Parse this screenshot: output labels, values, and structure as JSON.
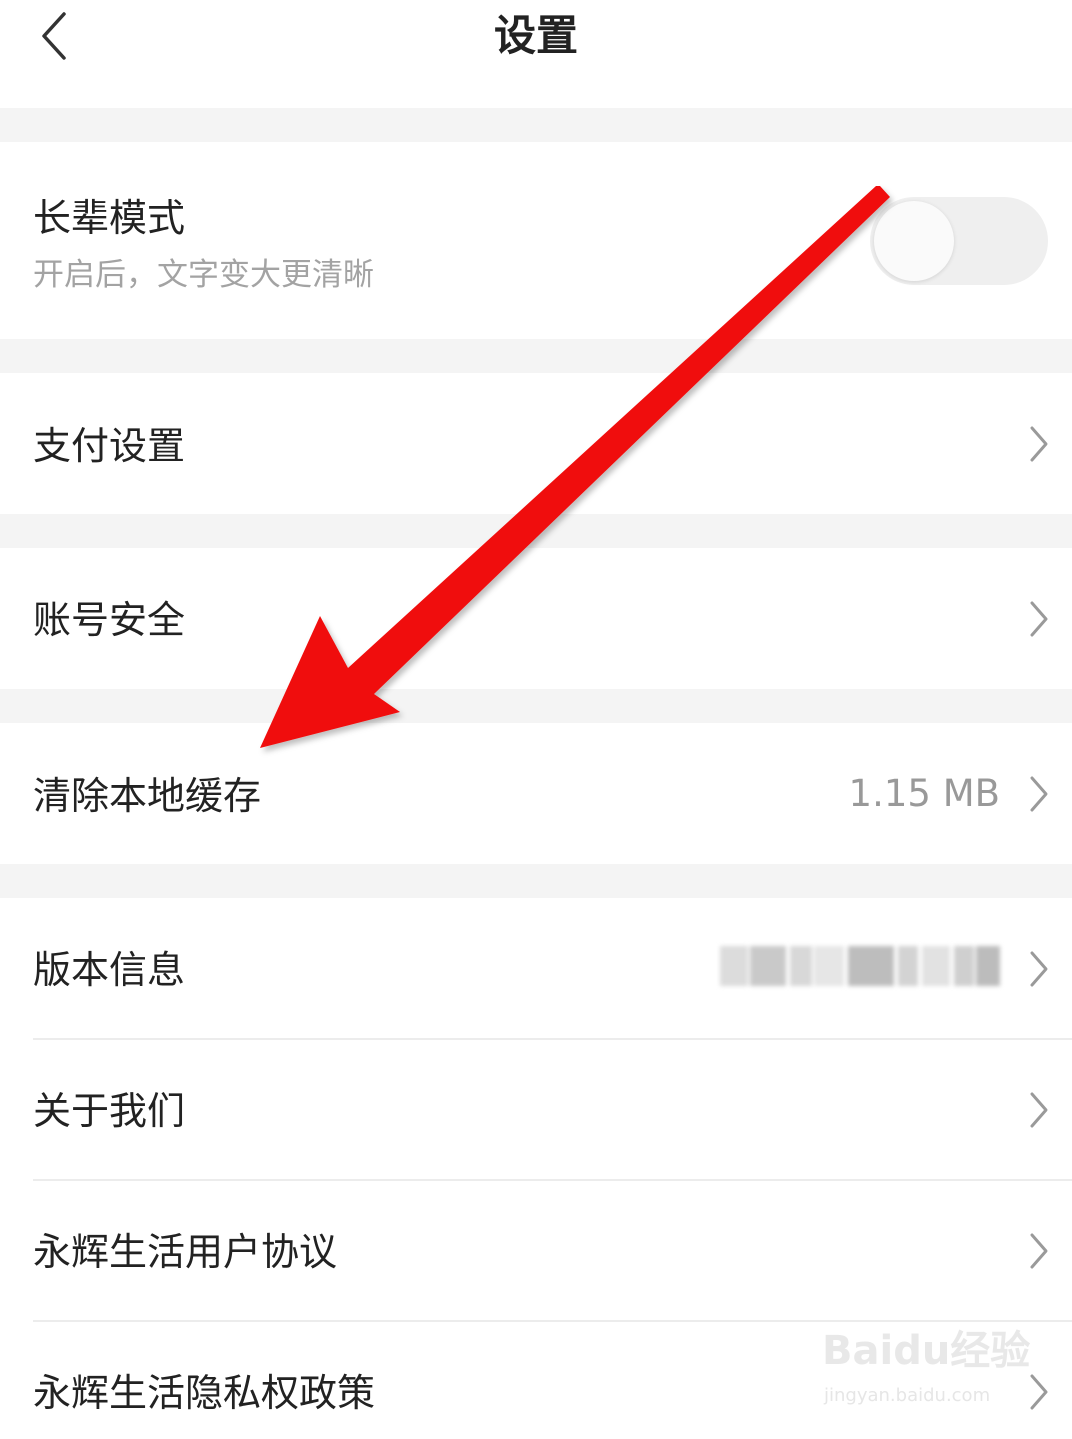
{
  "header": {
    "title": "设置",
    "back_icon": "chevron-left-icon"
  },
  "elder_mode": {
    "label": "长辈模式",
    "description": "开启后，文字变大更清晰",
    "toggle_on": false
  },
  "rows": {
    "payment": {
      "label": "支付设置"
    },
    "account_security": {
      "label": "账号安全"
    },
    "clear_cache": {
      "label": "清除本地缓存",
      "value": "1.15 MB"
    },
    "version": {
      "label": "版本信息"
    },
    "about": {
      "label": "关于我们"
    },
    "user_agreement": {
      "label": "永辉生活用户协议"
    },
    "privacy_policy": {
      "label": "永辉生活隐私权政策"
    }
  },
  "watermark": {
    "brand": "Baidu经验",
    "url": "jingyan.baidu.com"
  },
  "colors": {
    "annotation_arrow": "#f01010",
    "section_gap": "#f4f4f4",
    "secondary_text": "#a3a3a3"
  }
}
